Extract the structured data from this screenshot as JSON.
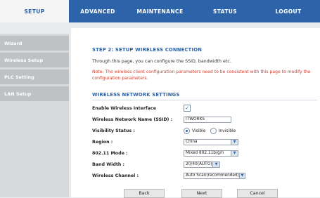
{
  "nav": {
    "tabs": [
      {
        "label": "SETUP"
      },
      {
        "label": "ADVANCED"
      },
      {
        "label": "MAINTENANCE"
      },
      {
        "label": "STATUS"
      },
      {
        "label": "LOGOUT"
      }
    ]
  },
  "sidebar": {
    "items": [
      {
        "label": "Wizard"
      },
      {
        "label": "Wireless Setup"
      },
      {
        "label": "PLC Setting"
      },
      {
        "label": "LAN Setup"
      }
    ]
  },
  "main": {
    "step_title": "STEP 2: SETUP WIRELESS CONNECTION",
    "description": "Through this page, you can configure the SSID, bandwidth etc.",
    "note": "Note: The wireless client configuration parameters need to be consistent with this page to modify the configuration parameters.",
    "section_title": "WIRELESS NETWORK SETTINGS",
    "fields": {
      "enable_label": "Enable Wireless Interface",
      "enable_checked": true,
      "ssid_label": "Wireless Network Name (SSID) :",
      "ssid_value": "ITWORKS",
      "visibility_label": "Visibility Status :",
      "visible_option": "Visible",
      "invisible_option": "Invisible",
      "visibility_selected": "Visible",
      "region_label": "Region :",
      "region_value": "China",
      "mode_label": "802.11 Mode :",
      "mode_value": "Mixed 802.11b/g/n",
      "bandwidth_label": "Band Width :",
      "bandwidth_value": "20/40(AUTO)",
      "channel_label": "Wireless Channel :",
      "channel_value": "Auto Scan(recommended)"
    },
    "buttons": {
      "back": "Back",
      "next": "Next",
      "cancel": "Cancel"
    }
  },
  "colors": {
    "nav_blue": "#2d63a8",
    "note_red": "#d13b2a",
    "sidebar_item": "#bfc2c5"
  }
}
